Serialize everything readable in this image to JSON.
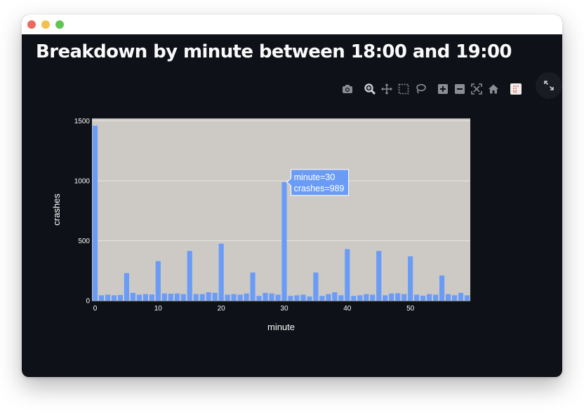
{
  "page": {
    "title": "Breakdown by minute between 18:00 and 19:00"
  },
  "toolbar": {
    "icons": [
      "camera-icon",
      "zoom-icon",
      "pan-icon",
      "box-select-icon",
      "lasso-icon",
      "zoom-in-icon",
      "zoom-out-icon",
      "autoscale-icon",
      "reset-axes-icon",
      "plotly-logo-icon",
      "fullscreen-icon"
    ]
  },
  "colors": {
    "background": "#0e1117",
    "plot_background": "#cdcac6",
    "bar": "#6b9cf5",
    "gridline": "#e6e4e1",
    "text": "#fafafa"
  },
  "chart_data": {
    "type": "bar",
    "title": "",
    "xlabel": "minute",
    "ylabel": "crashes",
    "x": [
      0,
      1,
      2,
      3,
      4,
      5,
      6,
      7,
      8,
      9,
      10,
      11,
      12,
      13,
      14,
      15,
      16,
      17,
      18,
      19,
      20,
      21,
      22,
      23,
      24,
      25,
      26,
      27,
      28,
      29,
      30,
      31,
      32,
      33,
      34,
      35,
      36,
      37,
      38,
      39,
      40,
      41,
      42,
      43,
      44,
      45,
      46,
      47,
      48,
      49,
      50,
      51,
      52,
      53,
      54,
      55,
      56,
      57,
      58,
      59
    ],
    "values": [
      1460,
      45,
      50,
      45,
      48,
      230,
      65,
      50,
      55,
      52,
      330,
      60,
      58,
      60,
      55,
      415,
      55,
      55,
      70,
      65,
      475,
      50,
      55,
      50,
      60,
      235,
      40,
      65,
      60,
      50,
      989,
      40,
      45,
      50,
      35,
      235,
      40,
      55,
      70,
      45,
      430,
      40,
      45,
      55,
      50,
      415,
      45,
      60,
      62,
      55,
      370,
      50,
      42,
      55,
      50,
      210,
      55,
      45,
      65,
      45
    ],
    "xlim": [
      0,
      60
    ],
    "ylim": [
      0,
      1520
    ],
    "x_ticks": [
      0,
      10,
      20,
      30,
      40,
      50
    ],
    "x_tick_labels": [
      "0",
      "10",
      "20",
      "30",
      "40",
      "50"
    ],
    "y_ticks": [
      0,
      500,
      1000,
      1500
    ],
    "y_tick_labels": [
      "0",
      "500",
      "1000",
      "1500"
    ],
    "grid": true,
    "tooltip": {
      "index": 30,
      "line1": "minute=30",
      "line2": "crashes=989"
    }
  }
}
